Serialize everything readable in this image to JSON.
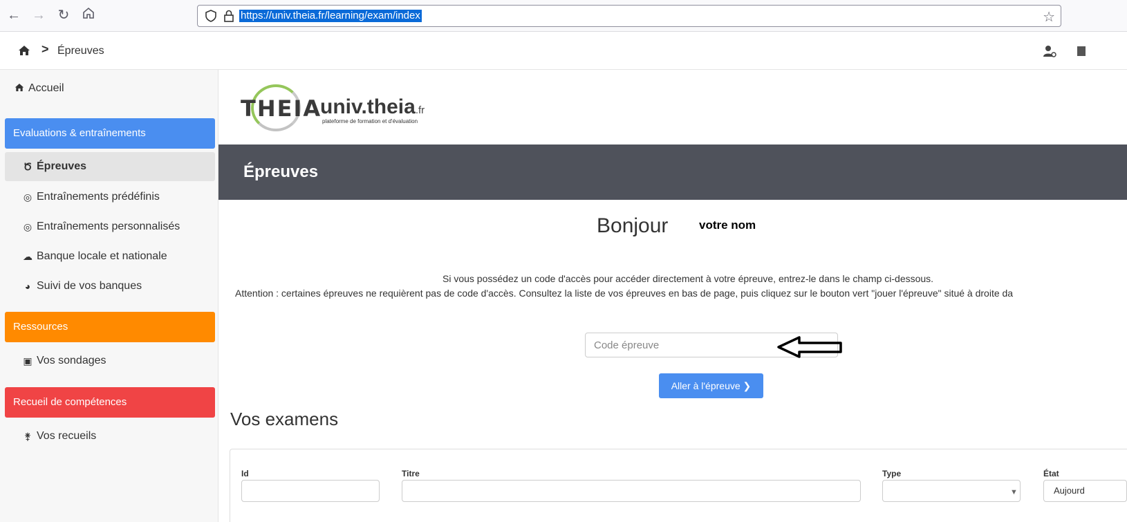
{
  "browser": {
    "url": "https://univ.theia.fr/learning/exam/index"
  },
  "breadcrumb": {
    "separator": ">",
    "current": "Épreuves"
  },
  "sidebar": {
    "home_label": "Accueil",
    "groups": [
      {
        "title": "Evaluations & entraînements",
        "color": "#4a8ef0"
      },
      {
        "title": "Ressources",
        "color": "#ff8a00"
      },
      {
        "title": "Recueil de compétences",
        "color": "#f04445"
      }
    ],
    "items": [
      {
        "label": "Épreuves",
        "icon": "medal-icon",
        "active": true
      },
      {
        "label": "Entraînements prédéfinis",
        "icon": "target-icon"
      },
      {
        "label": "Entraînements personnalisés",
        "icon": "target-icon"
      },
      {
        "label": "Banque locale et nationale",
        "icon": "cloud-icon"
      },
      {
        "label": "Suivi de vos banques",
        "icon": "dashboard-icon"
      },
      {
        "label": "Vos sondages",
        "icon": "poll-icon"
      },
      {
        "label": "Vos recueils",
        "icon": "seedling-icon"
      }
    ]
  },
  "logo": {
    "brand": "THEIA",
    "site": "univ.theia",
    "tld": ".fr",
    "tagline": "plateforme de formation et d'évaluation"
  },
  "page": {
    "title": "Épreuves",
    "greeting": "Bonjour",
    "user_name": "votre nom",
    "info_line1": "Si vous possédez un code d'accès pour accéder directement à votre épreuve, entrez-le dans le champ ci-dessous.",
    "info_line2": "Attention : certaines épreuves ne requièrent pas de code d'accès. Consultez la liste de vos épreuves en bas de page, puis cliquez sur le bouton vert \"jouer l'épreuve\" situé à droite da",
    "code_placeholder": "Code épreuve",
    "go_button": "Aller à l'épreuve ❯",
    "exams_title": "Vos examens"
  },
  "filters": {
    "id_label": "Id",
    "title_label": "Titre",
    "type_label": "Type",
    "state_label": "État",
    "state_value": "Aujourd"
  }
}
